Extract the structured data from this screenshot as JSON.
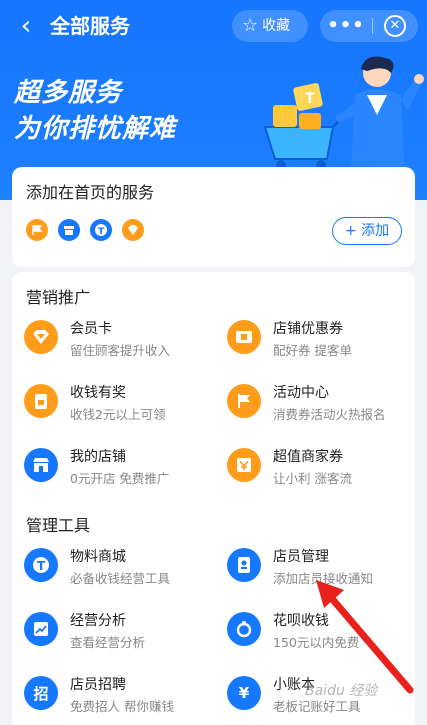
{
  "header": {
    "back_icon": "chevron-left-icon",
    "title": "全部服务",
    "favorite_label": "收藏",
    "more_icon": "ellipsis-icon",
    "close_icon": "circle-close-icon"
  },
  "banner": {
    "line1": "超多服务",
    "line2": "为你排忧解难"
  },
  "home_services": {
    "title": "添加在首页的服务",
    "icons": [
      "flag-icon",
      "shop-icon",
      "t-coin-icon",
      "diamond-icon"
    ],
    "add_label": "+ 添加"
  },
  "marketing": {
    "title": "营销推广",
    "items": [
      {
        "name": "会员卡",
        "desc": "留住顾客提升收入",
        "icon": "diamond-icon"
      },
      {
        "name": "店铺优惠券",
        "desc": "配好券 提客单",
        "icon": "coupon-icon"
      },
      {
        "name": "收钱有奖",
        "desc": "收钱2元以上可领",
        "icon": "gift-icon"
      },
      {
        "name": "活动中心",
        "desc": "消费券活动火热报名",
        "icon": "flag-icon"
      },
      {
        "name": "我的店铺",
        "desc": "0元开店 免费推广",
        "icon": "shop-icon"
      },
      {
        "name": "超值商家券",
        "desc": "让小利 涨客流",
        "icon": "voucher-icon"
      }
    ]
  },
  "tools": {
    "title": "管理工具",
    "items": [
      {
        "name": "物料商城",
        "desc": "必备收钱经营工具",
        "icon": "t-coin-icon"
      },
      {
        "name": "店员管理",
        "desc": "添加店员接收通知",
        "icon": "staff-card-icon"
      },
      {
        "name": "经营分析",
        "desc": "查看经营分析",
        "icon": "chart-icon"
      },
      {
        "name": "花呗收钱",
        "desc": "150元以内免费",
        "icon": "huabei-icon"
      },
      {
        "name": "店员招聘",
        "desc": "免费招人 帮你赚钱",
        "icon": "recruit-icon"
      },
      {
        "name": "小账本",
        "desc": "老板记账好工具",
        "icon": "ledger-icon"
      }
    ],
    "recruit_glyph": "招",
    "ledger_glyph": "¥"
  },
  "colors": {
    "primary": "#1677ff",
    "orange": "#ff9d1a",
    "annotation": "#e8211d"
  },
  "watermark": "Baidu 经验"
}
